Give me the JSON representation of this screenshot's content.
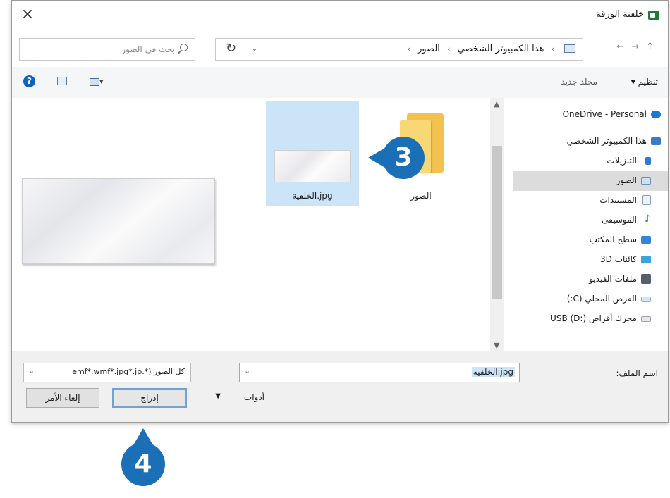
{
  "window": {
    "title": "خلفية الورقة",
    "close_glyph": "×"
  },
  "navigation": {
    "back_glyph": "←",
    "forward_glyph": "→",
    "up_glyph": "↑",
    "breadcrumbs": [
      "هذا الكمبيوتر الشخصي",
      "الصور"
    ],
    "crumb_separator": "›",
    "dropdown_glyph": "⌄",
    "refresh_glyph": "↻",
    "search_placeholder": "بحث في الصور"
  },
  "toolbar": {
    "organize_label": "تنظيم ▾",
    "new_folder_label": "مجلد جديد",
    "help_glyph": "?",
    "view_dropdown_glyph": "▾"
  },
  "nav_pane": {
    "items": [
      {
        "label": "OneDrive - Personal",
        "icon": "cloud-icon",
        "color": "#1e78d6"
      },
      {
        "label": "هذا الكمبيوتر الشخصي",
        "icon": "computer-icon",
        "color": "#3a7bc8"
      },
      {
        "label": "التنزيلات",
        "icon": "download-icon",
        "color": "#2a7bd6"
      },
      {
        "label": "الصور",
        "icon": "pictures-icon",
        "color": "#6a8fbf",
        "selected": true
      },
      {
        "label": "المستندات",
        "icon": "documents-icon",
        "color": "#8aa0b8"
      },
      {
        "label": "الموسيقى",
        "icon": "music-icon",
        "color": "#2a6fc4"
      },
      {
        "label": "سطح المكتب",
        "icon": "desktop-icon",
        "color": "#2f86dc"
      },
      {
        "label": "كائنات 3D",
        "icon": "3d-objects-icon",
        "color": "#35a4e0"
      },
      {
        "label": "ملفات الفيديو",
        "icon": "video-icon",
        "color": "#555e6a"
      },
      {
        "label": "القرص المحلي (C:)",
        "icon": "drive-icon",
        "color": "#8ab4da"
      },
      {
        "label": "محرك أقراص USB (D:)",
        "icon": "usb-drive-icon",
        "color": "#9aa4ae"
      }
    ]
  },
  "files": [
    {
      "name": "الصور",
      "type": "folder"
    },
    {
      "name": "jpg.الخلفية",
      "type": "image",
      "selected": true
    }
  ],
  "bottom": {
    "filename_label": "اسم الملف:",
    "filename_value": "jpg.الخلفية",
    "filetype_value": "كل الصور (*.emf*.wmf*.jpg*.jp",
    "tools_label": "أدوات",
    "insert_label": "إدراج",
    "cancel_label": "إلغاء الأمر"
  },
  "callouts": {
    "step3": "3",
    "step4": "4",
    "color": "#1a6fb7"
  }
}
